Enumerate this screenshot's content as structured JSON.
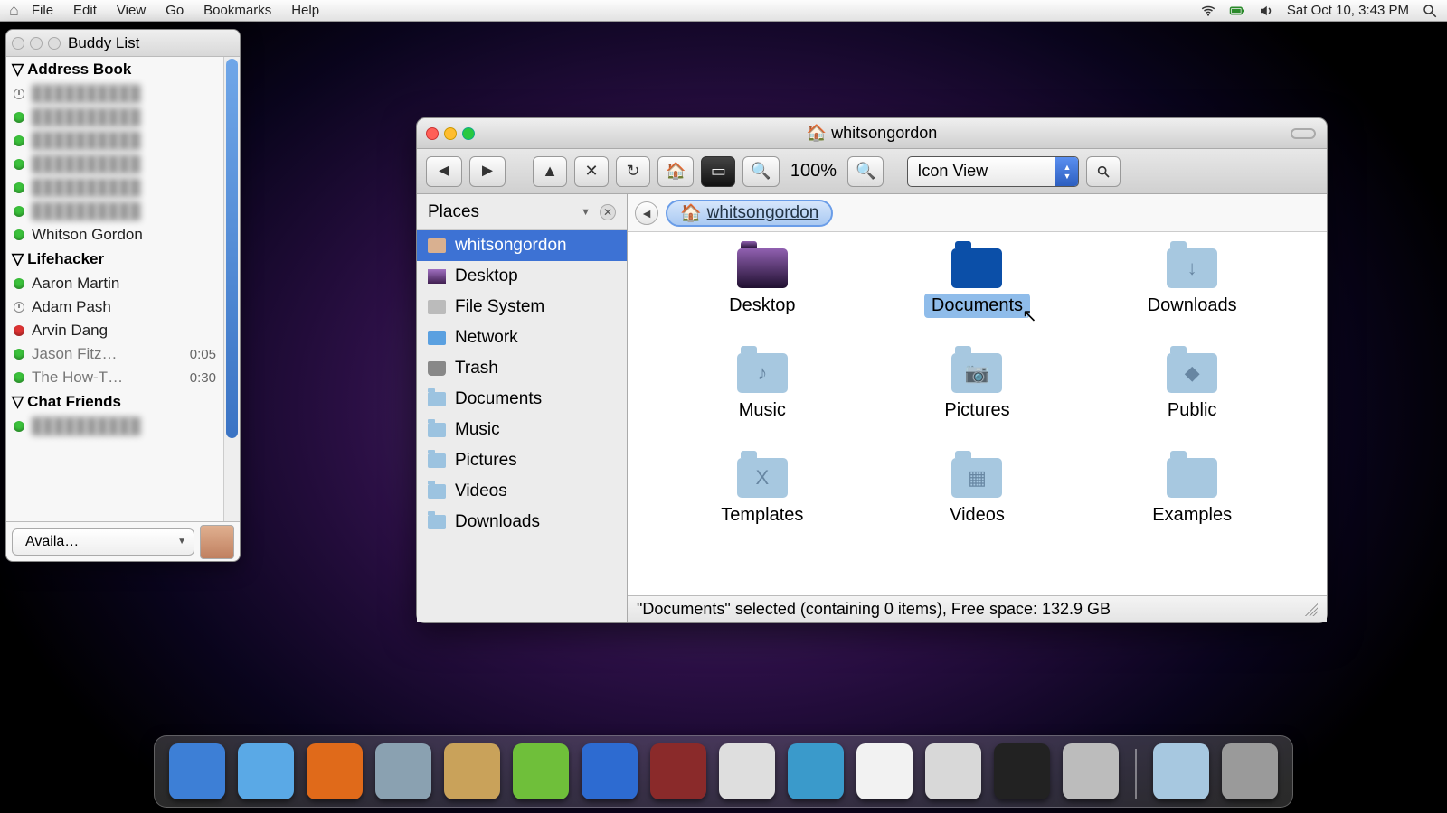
{
  "menubar": {
    "items": [
      "File",
      "Edit",
      "View",
      "Go",
      "Bookmarks",
      "Help"
    ],
    "clock": "Sat Oct 10, 3:43 PM"
  },
  "buddy": {
    "title": "Buddy List",
    "groups": [
      {
        "name": "Address Book",
        "contacts": [
          {
            "status": "clock",
            "name": "",
            "blur": true
          },
          {
            "status": "green",
            "name": "",
            "blur": true
          },
          {
            "status": "green",
            "name": "",
            "blur": true
          },
          {
            "status": "green",
            "name": "",
            "blur": true
          },
          {
            "status": "green",
            "name": "",
            "blur": true
          },
          {
            "status": "green",
            "name": "",
            "blur": true
          },
          {
            "status": "green",
            "name": "Whitson Gordon"
          }
        ]
      },
      {
        "name": "Lifehacker",
        "contacts": [
          {
            "status": "green",
            "name": "Aaron Martin"
          },
          {
            "status": "clock",
            "name": "Adam Pash"
          },
          {
            "status": "red",
            "name": "Arvin Dang"
          },
          {
            "status": "green",
            "name": "Jason Fitz…",
            "idle": true,
            "time": "0:05"
          },
          {
            "status": "green",
            "name": "The How-T…",
            "idle": true,
            "time": "0:30"
          }
        ]
      },
      {
        "name": "Chat Friends",
        "contacts": [
          {
            "status": "green",
            "name": "",
            "blur": true
          }
        ]
      }
    ],
    "status_label": "Availa…"
  },
  "fm": {
    "title": "whitsongordon",
    "zoom": "100%",
    "view": "Icon View",
    "sidebar_header": "Places",
    "breadcrumb": "whitsongordon",
    "places": [
      {
        "icon": "home",
        "label": "whitsongordon",
        "sel": true
      },
      {
        "icon": "desk",
        "label": "Desktop"
      },
      {
        "icon": "disk",
        "label": "File System"
      },
      {
        "icon": "net",
        "label": "Network"
      },
      {
        "icon": "trash",
        "label": "Trash"
      },
      {
        "icon": "folder",
        "label": "Documents"
      },
      {
        "icon": "folder",
        "label": "Music"
      },
      {
        "icon": "folder",
        "label": "Pictures"
      },
      {
        "icon": "folder",
        "label": "Videos"
      },
      {
        "icon": "folder",
        "label": "Downloads"
      }
    ],
    "items": [
      {
        "label": "Desktop",
        "icon": "desk"
      },
      {
        "label": "Documents",
        "icon": "darkblue",
        "sel": true
      },
      {
        "label": "Downloads",
        "icon": "blue",
        "glyph": "↓"
      },
      {
        "label": "Music",
        "icon": "blue",
        "glyph": "♪"
      },
      {
        "label": "Pictures",
        "icon": "blue",
        "glyph": "📷"
      },
      {
        "label": "Public",
        "icon": "blue",
        "glyph": "◆"
      },
      {
        "label": "Templates",
        "icon": "blue",
        "glyph": "X"
      },
      {
        "label": "Videos",
        "icon": "blue",
        "glyph": "▦"
      },
      {
        "label": "Examples",
        "icon": "blue"
      }
    ],
    "status": "\"Documents\" selected (containing 0 items), Free space: 132.9 GB"
  },
  "dock": {
    "items": [
      {
        "name": "anchor",
        "bg": "#3d7fd6"
      },
      {
        "name": "finder",
        "bg": "#5aa9e6"
      },
      {
        "name": "firefox",
        "bg": "#e06a1a"
      },
      {
        "name": "chrome",
        "bg": "#8aa1b1"
      },
      {
        "name": "pidgin-bird",
        "bg": "#c9a25a"
      },
      {
        "name": "pidgin",
        "bg": "#6fbf3a"
      },
      {
        "name": "itunes",
        "bg": "#2d6bd1"
      },
      {
        "name": "photobooth",
        "bg": "#8a2a2a"
      },
      {
        "name": "iphoto",
        "bg": "#dedede"
      },
      {
        "name": "feather",
        "bg": "#3a9acb"
      },
      {
        "name": "textedit",
        "bg": "#f2f2f2"
      },
      {
        "name": "calculator",
        "bg": "#d8d8d8"
      },
      {
        "name": "terminal",
        "bg": "#222"
      },
      {
        "name": "settings",
        "bg": "#bcbcbc"
      }
    ],
    "right": [
      {
        "name": "folder",
        "bg": "#a7c8e0"
      },
      {
        "name": "trash",
        "bg": "#9a9a9a"
      }
    ]
  }
}
